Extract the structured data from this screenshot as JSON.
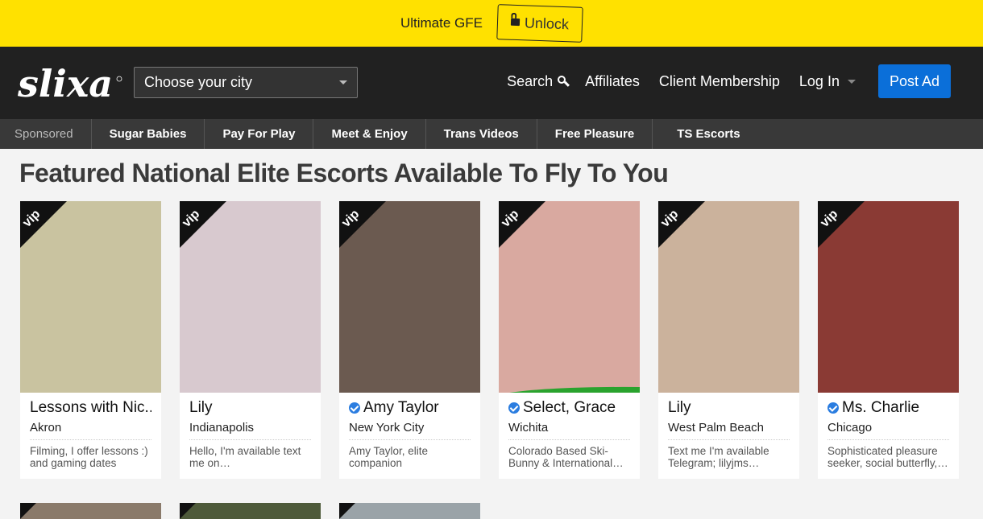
{
  "promo": {
    "text": "Ultimate GFE",
    "unlock_label": "Unlock"
  },
  "header": {
    "logo_text": "slixa",
    "city_select_value": "Choose your city",
    "nav": {
      "search": "Search",
      "affiliates": "Affiliates",
      "client_membership": "Client Membership",
      "login": "Log In",
      "post_ad": "Post Ad"
    }
  },
  "subnav": [
    "Sponsored",
    "Sugar Babies",
    "Pay For Play",
    "Meet & Enjoy",
    "Trans Videos",
    "Free Pleasure",
    "TS Escorts"
  ],
  "page_title": "Featured National Elite Escorts Available To Fly To You",
  "vip_label": "vip",
  "cards": [
    {
      "name": "Lessons with Nic...",
      "city": "Akron",
      "desc": "Filming, I offer lessons :) and gaming dates",
      "verified": false,
      "photo_color": "#c9c3a0"
    },
    {
      "name": "Lily",
      "city": "Indianapolis",
      "desc": "Hello, I'm available text me on…",
      "verified": false,
      "photo_color": "#d8c9cf"
    },
    {
      "name": "Amy Taylor",
      "city": "New York City",
      "desc": "Amy Taylor, elite companion",
      "verified": true,
      "photo_color": "#6b5a50"
    },
    {
      "name": "Select, Grace",
      "city": "Wichita",
      "desc": "Colorado Based Ski-Bunny & International…",
      "verified": true,
      "photo_color": "#d9a9a0"
    },
    {
      "name": "Lily",
      "city": "West Palm Beach",
      "desc": "Text me I'm available Telegram; lilyjms…",
      "verified": false,
      "photo_color": "#cbb29c"
    },
    {
      "name": "Ms. Charlie",
      "city": "Chicago",
      "desc": "Sophisticated pleasure seeker, social butterfly,…",
      "verified": true,
      "photo_color": "#8a3a34"
    }
  ]
}
